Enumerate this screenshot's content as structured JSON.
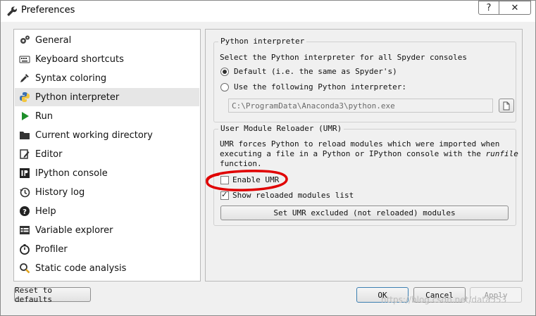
{
  "window": {
    "title": "Preferences"
  },
  "titlebar": {
    "help": "?",
    "close": "✕"
  },
  "sidebar": {
    "items": [
      {
        "label": "General",
        "icon": "gears-icon"
      },
      {
        "label": "Keyboard shortcuts",
        "icon": "keyboard-icon"
      },
      {
        "label": "Syntax coloring",
        "icon": "eyedropper-icon"
      },
      {
        "label": "Python interpreter",
        "icon": "python-icon",
        "selected": true
      },
      {
        "label": "Run",
        "icon": "play-icon"
      },
      {
        "label": "Current working directory",
        "icon": "folder-icon"
      },
      {
        "label": "Editor",
        "icon": "edit-icon"
      },
      {
        "label": "IPython console",
        "icon": "ipython-icon"
      },
      {
        "label": "History log",
        "icon": "history-icon"
      },
      {
        "label": "Help",
        "icon": "question-icon"
      },
      {
        "label": "Variable explorer",
        "icon": "table-icon"
      },
      {
        "label": "Profiler",
        "icon": "stopwatch-icon"
      },
      {
        "label": "Static code analysis",
        "icon": "magnifier-icon"
      }
    ]
  },
  "interpreter": {
    "group_title": "Python interpreter",
    "description": "Select the Python interpreter for all Spyder consoles",
    "default_label": "Default (i.e. the same as Spyder's)",
    "custom_label": "Use the following Python interpreter:",
    "path_value": "C:\\ProgramData\\Anaconda3\\python.exe"
  },
  "umr": {
    "group_title": "User Module Reloader (UMR)",
    "desc_line1": "UMR forces Python to reload modules which were imported when",
    "desc_line2a": "executing a file in a Python or IPython console with the ",
    "desc_line2b": "runfile",
    "desc_line3": "function.",
    "enable_label": "Enable UMR",
    "show_label": "Show reloaded modules list",
    "excluded_button": "Set UMR excluded (not reloaded) modules"
  },
  "footer": {
    "reset": "Reset to defaults",
    "ok": "OK",
    "cancel": "Cancel",
    "apply": "Apply"
  },
  "watermark": "https://blog.csdn.net/data553"
}
